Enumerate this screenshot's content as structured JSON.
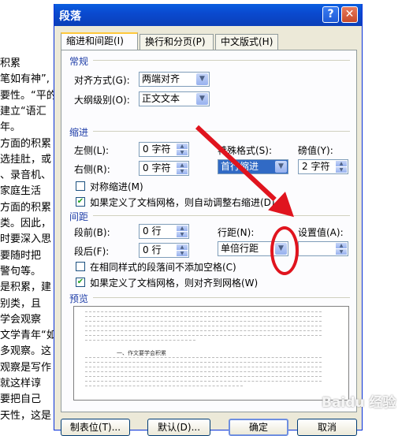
{
  "doc_lines_left": [
    "积累",
    "笔如有神”,",
    "要性。“平的",
    "建立“语汇",
    "年。",
    "方面的积累",
    "选挂肚，或",
    "、录音机、",
    "家庭生活",
    "方面的积累",
    "类。因此，",
    "时要深入思",
    "要随时把",
    "警句等。",
    "是积累，建",
    "别类，且",
    "学会观察",
    "文学青年“如",
    "多观察。这",
    "观察是写作",
    "就这样谆",
    "要把自己",
    "天性，这是"
  ],
  "dialog": {
    "title": "段落",
    "help_glyph": "?",
    "close_glyph": "✕",
    "tabs": [
      "缩进和间距(I)",
      "换行和分页(P)",
      "中文版式(H)"
    ],
    "general": {
      "group": "常规",
      "alignment_label": "对齐方式(G):",
      "alignment_value": "两端对齐",
      "outline_label": "大纲级别(O):",
      "outline_value": "正文文本"
    },
    "indent": {
      "group": "缩进",
      "left_label": "左侧(L):",
      "left_value": "0 字符",
      "right_label": "右侧(R):",
      "right_value": "0 字符",
      "special_label": "特殊格式(S):",
      "special_value": "首行缩进",
      "by_label": "磅值(Y):",
      "by_value": "2 字符",
      "mirror_label": "对称缩进(M)",
      "auto_label": "如果定义了文档网格，则自动调整右缩进(D)"
    },
    "spacing": {
      "group": "间距",
      "before_label": "段前(B):",
      "before_value": "0 行",
      "after_label": "段后(F):",
      "after_value": "0 行",
      "line_label": "行距(N):",
      "line_value": "单倍行距",
      "at_label": "设置值(A):",
      "at_value": "",
      "nospace_label": "在相同样式的段落间不添加空格(C)",
      "grid_label": "如果定义了文档网格，则对齐到网格(W)"
    },
    "preview": {
      "group": "预览",
      "sample_text": "一、作文要学会积累"
    },
    "buttons": {
      "tabs": "制表位(T)...",
      "default": "默认(D)...",
      "ok": "确定",
      "cancel": "取消"
    }
  },
  "watermark": "Baidu 经验",
  "colors": {
    "title_bar": "#0a4ad0",
    "annotation": "#e0141e",
    "dialog_bg": "#ece9d8"
  }
}
